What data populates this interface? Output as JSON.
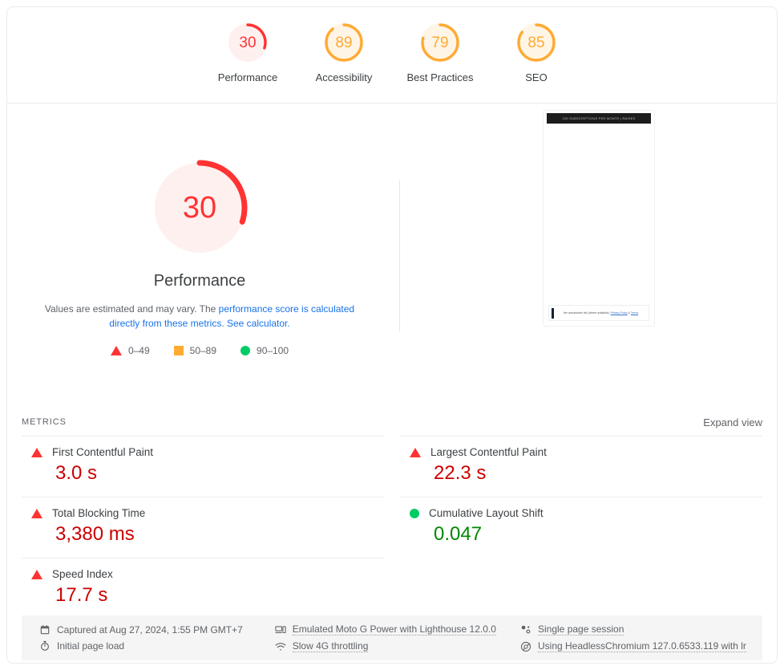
{
  "scores": [
    {
      "value": "30",
      "label": "Performance",
      "color": "#f33",
      "bg": "#fff0f0",
      "pct": 30
    },
    {
      "value": "89",
      "label": "Accessibility",
      "color": "#fa3",
      "bg": "#fff5e6",
      "pct": 89
    },
    {
      "value": "79",
      "label": "Best Practices",
      "color": "#fa3",
      "bg": "#fff5e6",
      "pct": 79
    },
    {
      "value": "85",
      "label": "SEO",
      "color": "#fa3",
      "bg": "#fff5e6",
      "pct": 85
    }
  ],
  "performance": {
    "score": "30",
    "title": "Performance",
    "score_color": "#f33",
    "score_bg": "#fff0f0",
    "pct": 30,
    "description_part1": "Values are estimated and may vary. The ",
    "description_link1": "performance score is calculated directly from these metrics",
    "description_part2": ". ",
    "description_link2": "See calculator.",
    "legend": [
      {
        "shape": "triangle",
        "range": "0–49",
        "color": "#f33"
      },
      {
        "shape": "square",
        "range": "50–89",
        "color": "#fa3"
      },
      {
        "shape": "circle",
        "range": "90–100",
        "color": "#0c6"
      }
    ]
  },
  "screenshot_preview": {
    "banner_text": "100 SUBSCRIPTIONS PER MONTH | RAISES",
    "cookie_text_part1": "the unsubscribe link (where available). ",
    "cookie_link1": "Privacy Policy",
    "cookie_text_part2": " & ",
    "cookie_link2": "Terms",
    "cookie_text_part3": "."
  },
  "metrics_section": {
    "title": "METRICS",
    "expand_view": "Expand view",
    "left_column": [
      {
        "name": "First Contentful Paint",
        "value": "3.0 s",
        "rating": "fail"
      },
      {
        "name": "Total Blocking Time",
        "value": "3,380 ms",
        "rating": "fail"
      },
      {
        "name": "Speed Index",
        "value": "17.7 s",
        "rating": "fail"
      }
    ],
    "right_column": [
      {
        "name": "Largest Contentful Paint",
        "value": "22.3 s",
        "rating": "fail"
      },
      {
        "name": "Cumulative Layout Shift",
        "value": "0.047",
        "rating": "pass"
      }
    ]
  },
  "meta": {
    "column1": [
      {
        "icon": "calendar-icon",
        "text": "Captured at Aug 27, 2024, 1:55 PM GMT+7",
        "style": "plain"
      },
      {
        "icon": "stopwatch-icon",
        "text": "Initial page load",
        "style": "plain"
      }
    ],
    "column2": [
      {
        "icon": "devices-icon",
        "text": "Emulated Moto G Power with Lighthouse 12.0.0",
        "style": "dotted"
      },
      {
        "icon": "network-icon",
        "text": "Slow 4G throttling",
        "style": "dotted"
      }
    ],
    "column3": [
      {
        "icon": "single-session-icon",
        "text": "Single page session",
        "style": "dotted"
      },
      {
        "icon": "chrome-icon",
        "text": "Using HeadlessChromium 127.0.6533.119 with lr",
        "style": "dotted"
      }
    ]
  }
}
